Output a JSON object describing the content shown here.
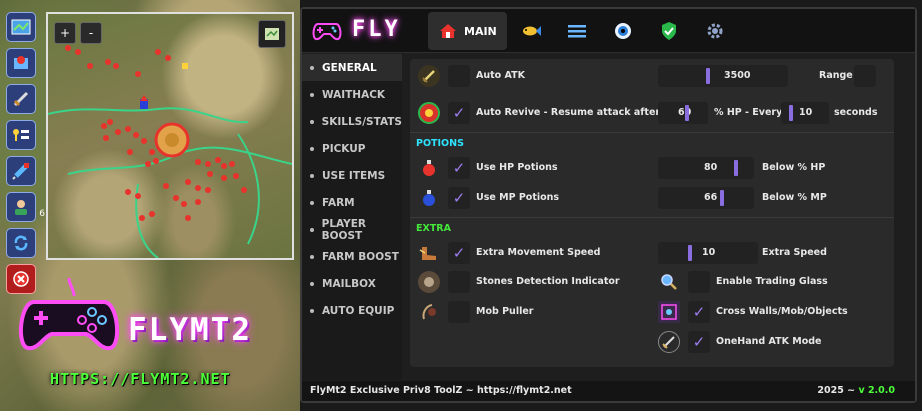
{
  "brand": {
    "title": "FLY",
    "logo_text": "FLYMT2",
    "logo_url": "HTTPS://FLYMT2.NET"
  },
  "minimap": {
    "zoom_in": "+",
    "zoom_out": "-"
  },
  "left_toolbar": {
    "side_counter": "6"
  },
  "tabs": [
    {
      "label": "MAIN",
      "icon": "home-icon"
    },
    {
      "label": "",
      "icon": "fish-icon"
    },
    {
      "label": "",
      "icon": "list-icon"
    },
    {
      "label": "",
      "icon": "eye-icon"
    },
    {
      "label": "",
      "icon": "shield-check-icon"
    },
    {
      "label": "",
      "icon": "gear-icon"
    }
  ],
  "sidebar": {
    "items": [
      {
        "label": "GENERAL"
      },
      {
        "label": "WAITHACK"
      },
      {
        "label": "SKILLS/STATS"
      },
      {
        "label": "PICKUP"
      },
      {
        "label": "USE ITEMS"
      },
      {
        "label": "FARM"
      },
      {
        "label": "PLAYER BOOST"
      },
      {
        "label": "FARM BOOST"
      },
      {
        "label": "MAILBOX"
      },
      {
        "label": "AUTO EQUIP"
      }
    ]
  },
  "main": {
    "auto_atk": {
      "label": "Auto ATK",
      "value": "3500",
      "unit": "Range",
      "checked": false,
      "level": 0.19
    },
    "auto_revive": {
      "label": "Auto Revive - Resume attack after",
      "hp_value": "60",
      "hp_unit": "% HP - Every",
      "sec_value": "10",
      "sec_unit": "seconds",
      "checked": true
    },
    "potions_title": "POTIONS",
    "hp_potions": {
      "label": "Use HP Potions",
      "value": "80",
      "unit": "Below % HP",
      "checked": true,
      "level": 0.8
    },
    "mp_potions": {
      "label": "Use MP Potions",
      "value": "66",
      "unit": "Below % MP",
      "checked": true,
      "level": 0.66
    },
    "extra_title": "EXTRA",
    "extra_speed": {
      "label": "Extra Movement Speed",
      "value": "10",
      "unit": "Extra Speed",
      "checked": true
    },
    "stones": {
      "label": "Stones Detection Indicator",
      "checked": false
    },
    "mob_puller": {
      "label": "Mob Puller",
      "checked": false
    },
    "trading_glass": {
      "label": "Enable Trading Glass",
      "checked": false
    },
    "cross_walls": {
      "label": "Cross Walls/Mob/Objects",
      "checked": true
    },
    "onehand": {
      "label": "OneHand ATK Mode",
      "checked": true
    }
  },
  "footer": {
    "left": "FlyMt2 Exclusive Priv8 ToolZ ~ https://flymt2.net",
    "year": "2025 ~",
    "version": "v 2.0.0"
  },
  "colors": {
    "accent": "#8a6ee0",
    "potions": "#2de3ff",
    "extra": "#43e83a",
    "neon_pink": "#ff4df5",
    "neon_green": "#4cff3a"
  }
}
